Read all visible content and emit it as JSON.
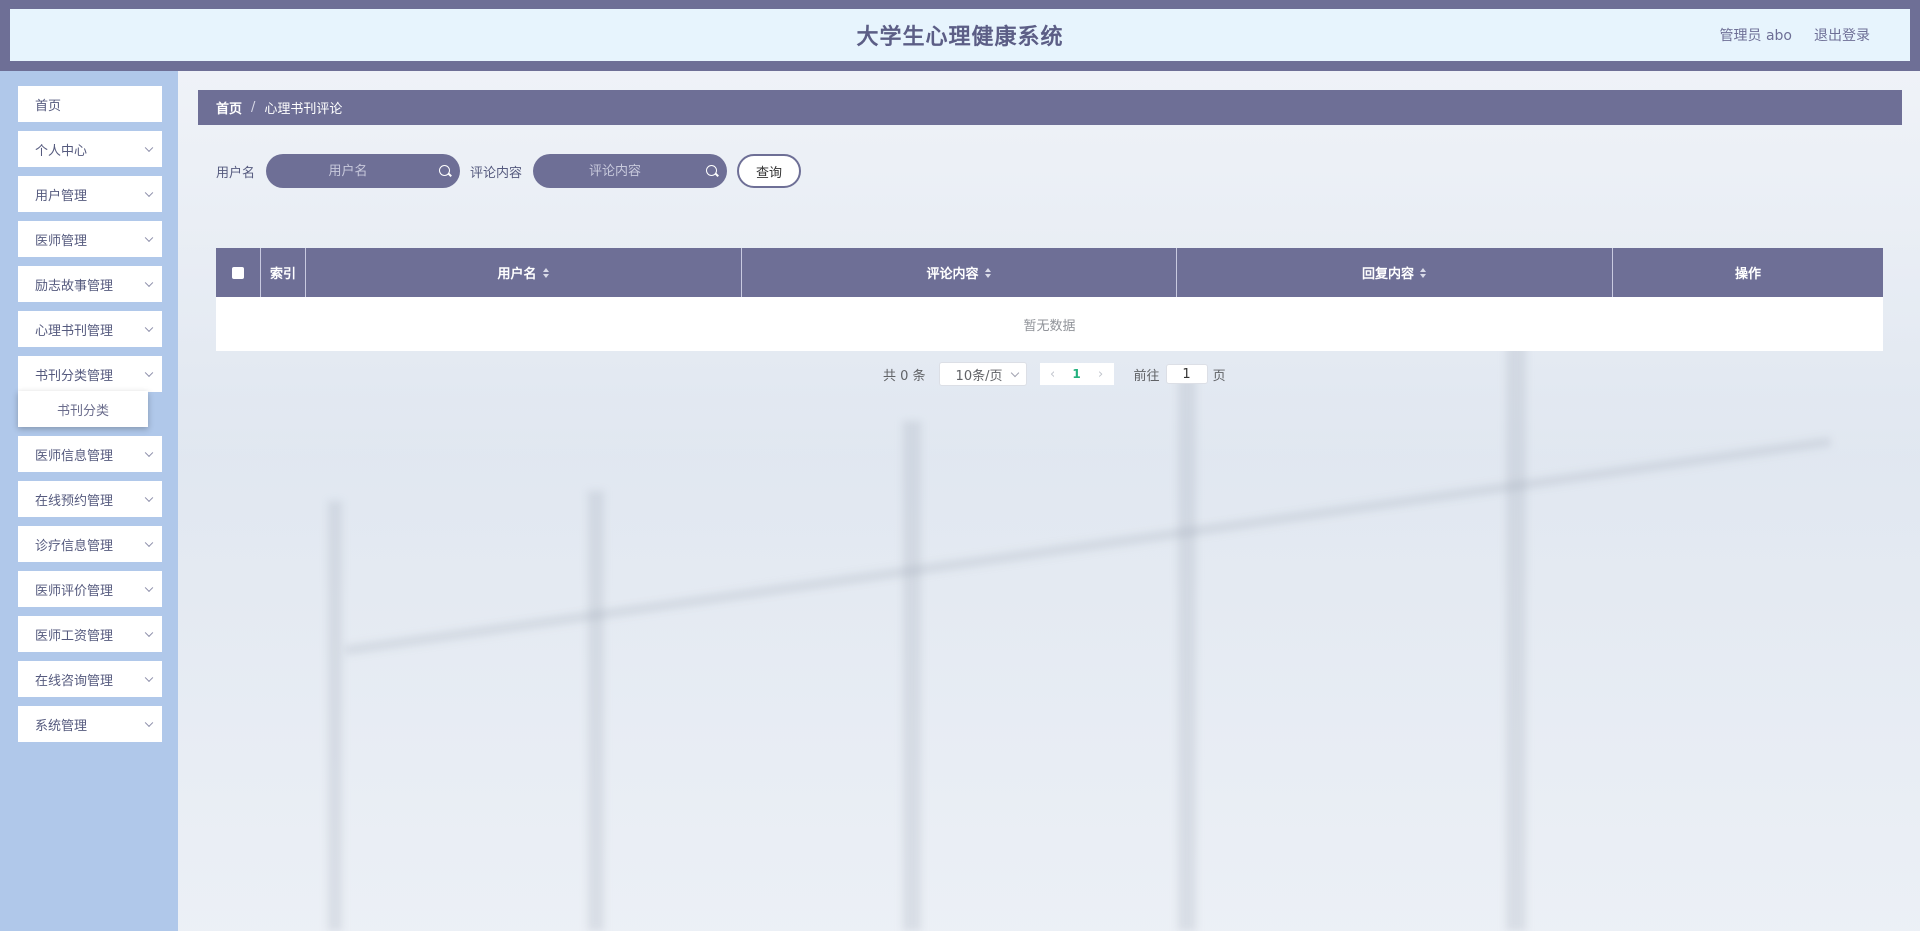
{
  "header": {
    "title": "大学生心理健康系统",
    "user_label": "管理员 abo",
    "logout_label": "退出登录"
  },
  "sidebar": {
    "items": [
      {
        "label": "首页",
        "has_arrow": false
      },
      {
        "label": "个人中心",
        "has_arrow": true
      },
      {
        "label": "用户管理",
        "has_arrow": true
      },
      {
        "label": "医师管理",
        "has_arrow": true
      },
      {
        "label": "励志故事管理",
        "has_arrow": true
      },
      {
        "label": "心理书刊管理",
        "has_arrow": true
      },
      {
        "label": "书刊分类管理",
        "has_arrow": true
      },
      {
        "label": "医师信息管理",
        "has_arrow": true
      },
      {
        "label": "在线预约管理",
        "has_arrow": true
      },
      {
        "label": "诊疗信息管理",
        "has_arrow": true
      },
      {
        "label": "医师评价管理",
        "has_arrow": true
      },
      {
        "label": "医师工资管理",
        "has_arrow": true
      },
      {
        "label": "在线咨询管理",
        "has_arrow": true
      },
      {
        "label": "系统管理",
        "has_arrow": true
      }
    ],
    "submenu": {
      "label": "书刊分类"
    }
  },
  "breadcrumb": {
    "home": "首页",
    "separator": "/",
    "current": "心理书刊评论"
  },
  "search": {
    "username_label": "用户名",
    "username_placeholder": "用户名",
    "comment_label": "评论内容",
    "comment_placeholder": "评论内容",
    "query_button": "查询"
  },
  "table": {
    "columns": [
      {
        "label": "",
        "type": "checkbox"
      },
      {
        "label": "索引",
        "sortable": false
      },
      {
        "label": "用户名",
        "sortable": true
      },
      {
        "label": "评论内容",
        "sortable": true
      },
      {
        "label": "回复内容",
        "sortable": true
      },
      {
        "label": "操作",
        "sortable": false
      }
    ],
    "empty_text": "暂无数据"
  },
  "pagination": {
    "total_text": "共 0 条",
    "page_size": "10条/页",
    "current_page": "1",
    "goto_label": "前往",
    "goto_value": "1",
    "goto_suffix": "页"
  },
  "colors": {
    "accent": "#6e6f96",
    "header_bg": "#e7f4fd",
    "sidebar_bg": "#b0c8ea",
    "active_page": "#22b07d"
  }
}
